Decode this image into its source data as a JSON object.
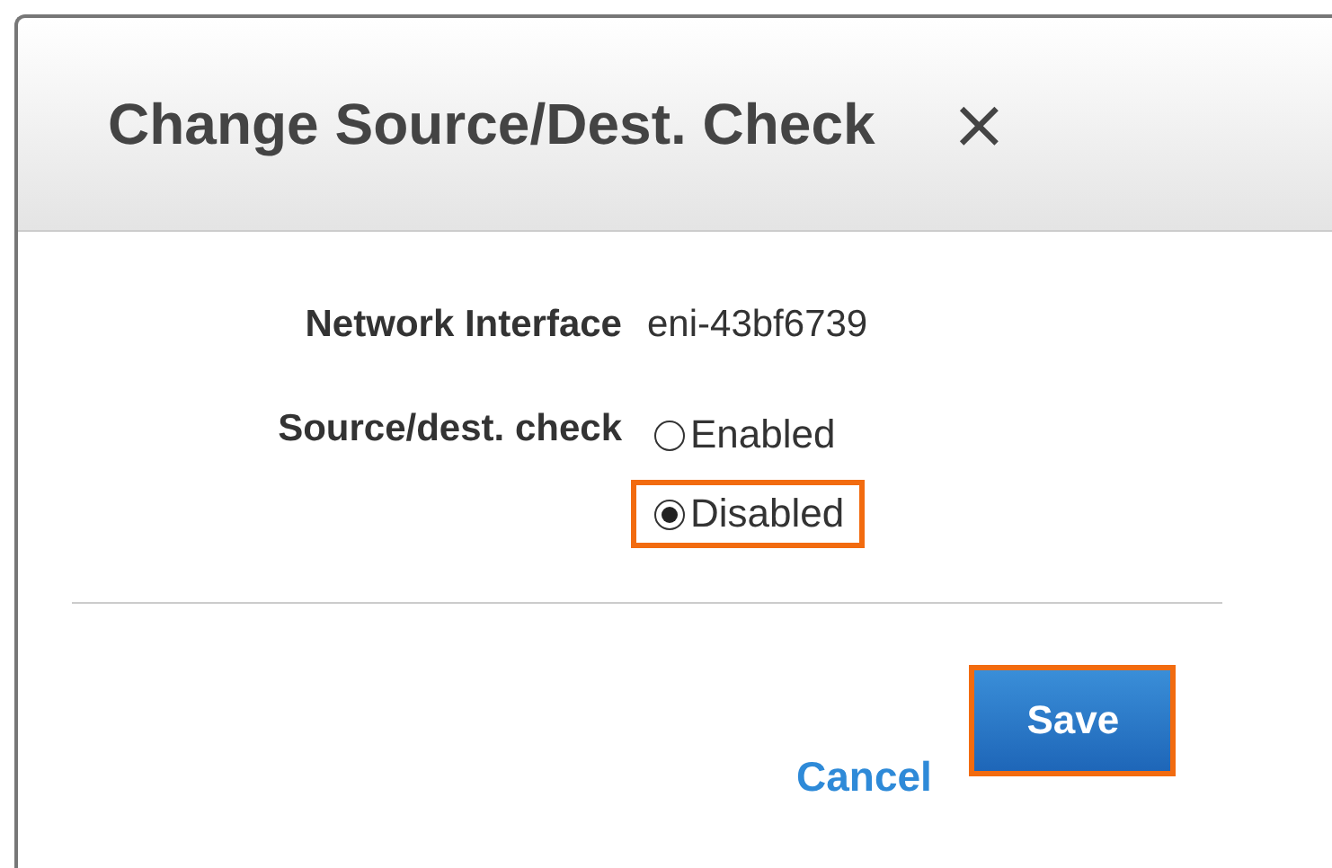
{
  "dialog": {
    "title": "Change Source/Dest. Check",
    "close": "×"
  },
  "fields": [
    {
      "label": "Network Interface",
      "value": "eni-43bf6739"
    }
  ],
  "radio_group": {
    "label": "Source/dest. check",
    "options": [
      {
        "label": "Enabled",
        "selected": false,
        "highlighted": false
      },
      {
        "label": "Disabled",
        "selected": true,
        "highlighted": true
      }
    ]
  },
  "buttons": [
    {
      "kind": "link",
      "label": "Cancel",
      "highlighted": false
    },
    {
      "kind": "primary",
      "label": "Save",
      "highlighted": true
    }
  ]
}
